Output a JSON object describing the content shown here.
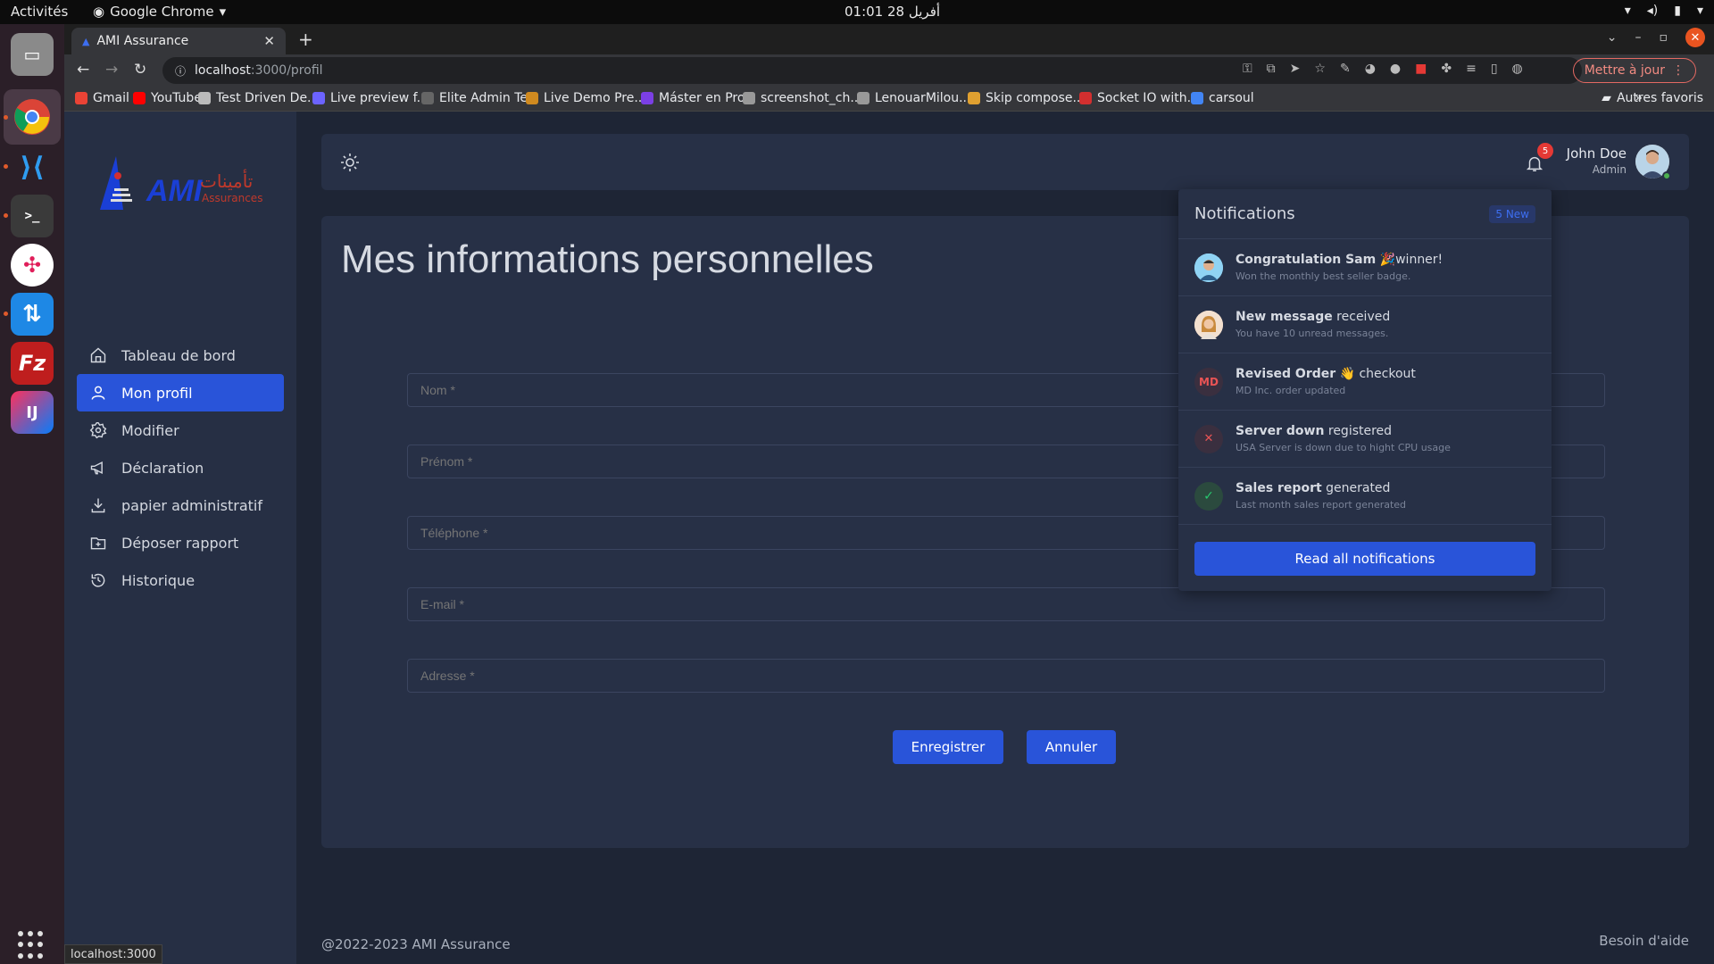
{
  "os": {
    "activities": "Activités",
    "app_menu": "Google Chrome",
    "clock": "أفريل 28  01:01"
  },
  "browser": {
    "tab_title": "AMI Assurance",
    "url_host": "localhost",
    "url_path": ":3000/profil",
    "update_label": "Mettre à jour",
    "status_url": "localhost:3000",
    "bookmarks": [
      {
        "label": "Gmail",
        "color": "#ea4335"
      },
      {
        "label": "YouTube",
        "color": "#ff0000"
      },
      {
        "label": "Test Driven De...",
        "color": "#bbbbbb"
      },
      {
        "label": "Live preview f...",
        "color": "#6c63ff"
      },
      {
        "label": "Elite Admin Te...",
        "color": "#666666"
      },
      {
        "label": "Live Demo Pre...",
        "color": "#d08a1f"
      },
      {
        "label": "Máster en Pro...",
        "color": "#7b3fe4"
      },
      {
        "label": "screenshot_ch...",
        "color": "#999999"
      },
      {
        "label": "LenouarMilou...",
        "color": "#999999"
      },
      {
        "label": "Skip compose...",
        "color": "#e0a030"
      },
      {
        "label": "Socket IO with...",
        "color": "#d32f2f"
      },
      {
        "label": "carsoul",
        "color": "#4285f4"
      }
    ],
    "more_bookmarks": "»",
    "other_bookmarks": "Autres favoris"
  },
  "app": {
    "logo_arabic": "تأمينات",
    "logo_text": "AMI",
    "logo_sub": "Assurances",
    "menu": [
      {
        "label": "Tableau de bord",
        "icon": "home-icon"
      },
      {
        "label": "Mon profil",
        "icon": "user-icon"
      },
      {
        "label": "Modifier",
        "icon": "gear-icon"
      },
      {
        "label": "Déclaration",
        "icon": "megaphone-icon"
      },
      {
        "label": "papier administratif",
        "icon": "download-icon"
      },
      {
        "label": "Déposer rapport",
        "icon": "upload-folder-icon"
      },
      {
        "label": "Historique",
        "icon": "history-icon"
      }
    ],
    "user_name": "John Doe",
    "user_role": "Admin",
    "notif_count": "5",
    "page_title": "Mes informations personnelles",
    "fields": [
      {
        "placeholder": "Nom *"
      },
      {
        "placeholder": "Prénom *"
      },
      {
        "placeholder": "Téléphone *"
      },
      {
        "placeholder": "E-mail *"
      },
      {
        "placeholder": "Adresse *"
      }
    ],
    "save_label": "Enregistrer",
    "cancel_label": "Annuler",
    "footer_left": "@2022-2023 AMI Assurance",
    "footer_right": "Besoin d'aide",
    "accent": "#2954d9"
  },
  "notifications": {
    "title": "Notifications",
    "new_badge": "5 New",
    "items": [
      {
        "bold": "Congratulation Sam",
        "rest": " 🎉winner!",
        "sub": "Won the monthly best seller badge.",
        "icon": "avatar-sam"
      },
      {
        "bold": "New message",
        "rest": " received",
        "sub": "You have 10 unread messages.",
        "icon": "avatar-woman"
      },
      {
        "bold": "Revised Order",
        "rest": " 👋 checkout",
        "sub": "MD Inc. order updated",
        "icon": "MD"
      },
      {
        "bold": "Server down",
        "rest": " registered",
        "sub": "USA Server is down due to hight CPU usage",
        "icon": "x-icon"
      },
      {
        "bold": "Sales report",
        "rest": " generated",
        "sub": "Last month sales report generated",
        "icon": "check-icon"
      }
    ],
    "read_all": "Read all notifications"
  }
}
